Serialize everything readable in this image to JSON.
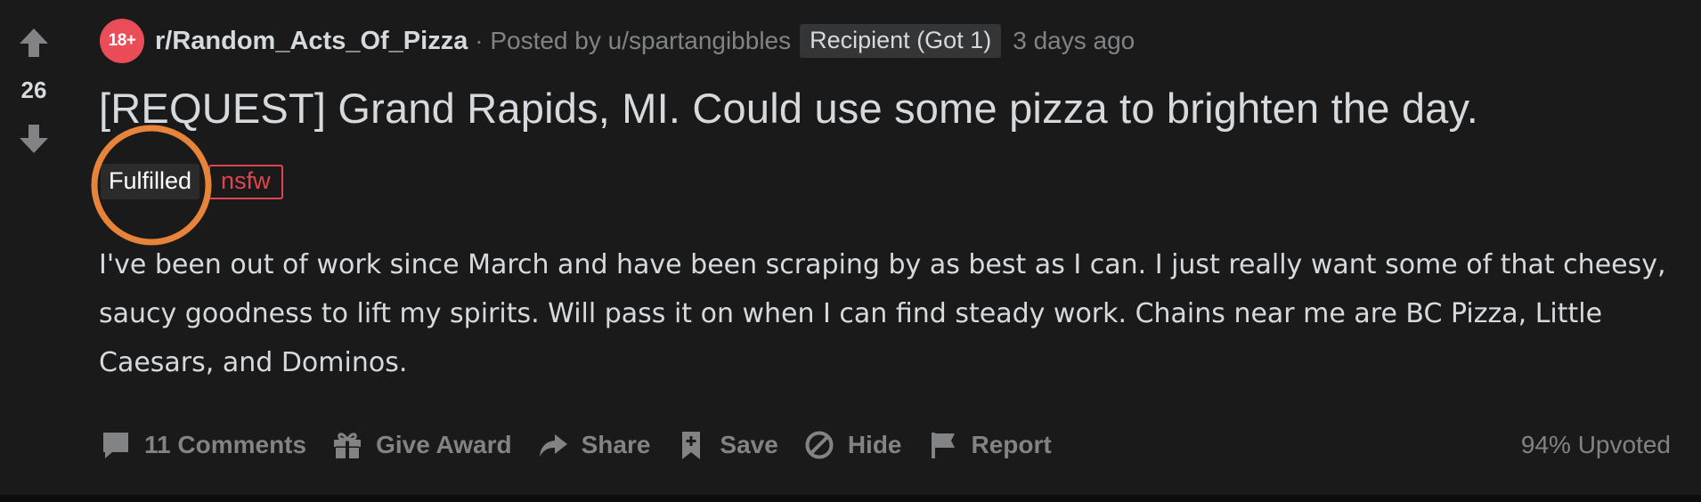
{
  "vote": {
    "score": "26",
    "upvote_icon": "arrow-up-icon",
    "downvote_icon": "arrow-down-icon"
  },
  "header": {
    "subreddit_icon_text": "18+",
    "subreddit": "r/Random_Acts_Of_Pizza",
    "separator": "·",
    "posted_by_prefix": "Posted by",
    "author": "u/spartangibbles",
    "user_flair": "Recipient (Got 1)",
    "time": "3 days ago"
  },
  "post": {
    "title": "[REQUEST] Grand Rapids, MI. Could use some pizza to brighten the day.",
    "tags": {
      "fulfilled": "Fulfilled",
      "nsfw": "nsfw"
    },
    "body": "I've been out of work since March and have been scraping by as best as I can. I just really want some of that cheesy, saucy goodness to lift my spirits. Will pass it on when I can find steady work. Chains near me are BC Pizza, Little Caesars, and Dominos."
  },
  "actions": {
    "comments": "11 Comments",
    "give_award": "Give Award",
    "share": "Share",
    "save": "Save",
    "hide": "Hide",
    "report": "Report",
    "upvote_ratio": "94% Upvoted"
  },
  "colors": {
    "background": "#1a1a1b",
    "text": "#d7dadc",
    "muted": "#818384",
    "subreddit_icon": "#ea4c58",
    "nsfw": "#e0454f",
    "annotation": "#e8843a"
  }
}
